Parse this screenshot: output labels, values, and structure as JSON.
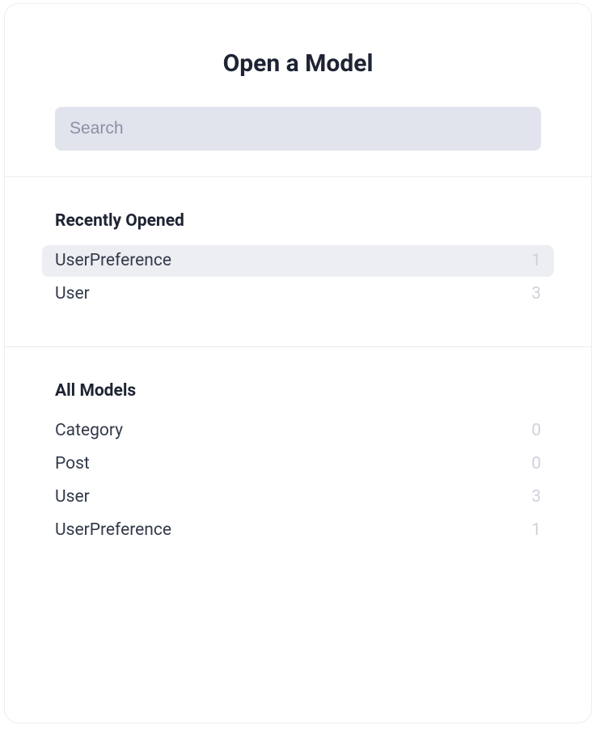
{
  "title": "Open a Model",
  "search": {
    "placeholder": "Search",
    "value": ""
  },
  "sections": {
    "recent": {
      "title": "Recently Opened",
      "items": [
        {
          "name": "UserPreference",
          "count": "1",
          "highlighted": true
        },
        {
          "name": "User",
          "count": "3",
          "highlighted": false
        }
      ]
    },
    "all": {
      "title": "All Models",
      "items": [
        {
          "name": "Category",
          "count": "0",
          "highlighted": false
        },
        {
          "name": "Post",
          "count": "0",
          "highlighted": false
        },
        {
          "name": "User",
          "count": "3",
          "highlighted": false
        },
        {
          "name": "UserPreference",
          "count": "1",
          "highlighted": false
        }
      ]
    }
  }
}
